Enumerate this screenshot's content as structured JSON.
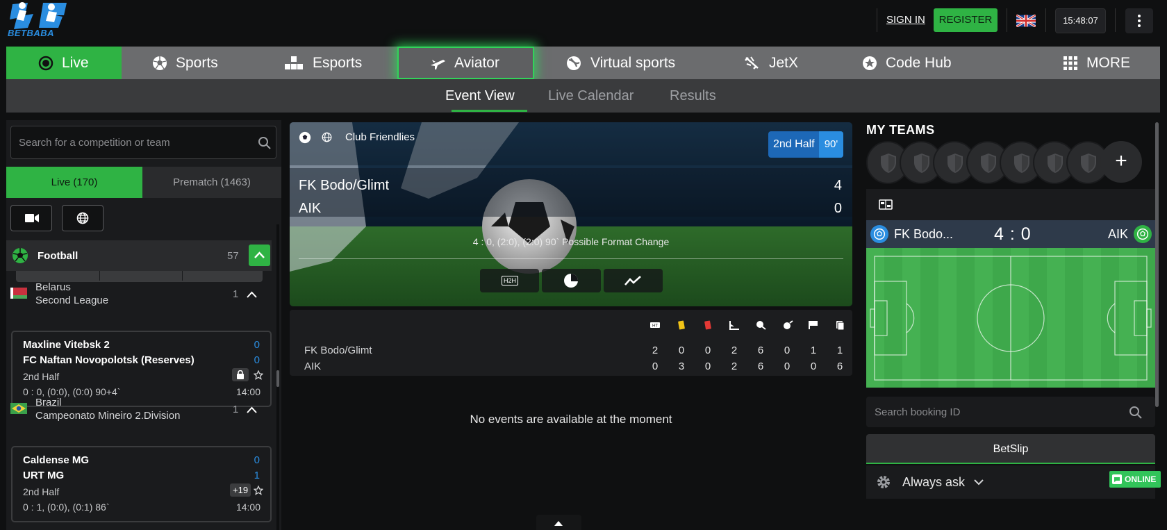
{
  "brand": {
    "logo_text": "BETBABA"
  },
  "header": {
    "signin": "SIGN IN",
    "register": "REGISTER",
    "clock": "15:48:07"
  },
  "nav": [
    {
      "label": "Live"
    },
    {
      "label": "Sports"
    },
    {
      "label": "Esports"
    },
    {
      "label": "Aviator"
    },
    {
      "label": "Virtual sports"
    },
    {
      "label": "JetX"
    },
    {
      "label": "Code Hub"
    },
    {
      "label": "MORE"
    }
  ],
  "subnav": {
    "event_view": "Event View",
    "live_calendar": "Live Calendar",
    "results": "Results"
  },
  "sidebar": {
    "search_placeholder": "Search for a competition or team",
    "tab_live": "Live (170)",
    "tab_prematch": "Prematch (1463)",
    "sport": {
      "label": "Football",
      "count": "57"
    },
    "leagues": [
      {
        "country": "Belarus",
        "name": "Second League",
        "count": "1",
        "match": {
          "home": "Maxline Vitebsk 2",
          "away": "FC Naftan Novopolotsk (Reserves)",
          "home_score": "0",
          "away_score": "0",
          "period": "2nd Half",
          "score_line": "0 : 0, (0:0), (0:0) 90+4`",
          "time": "14:00",
          "badge": ""
        }
      },
      {
        "country": "Brazil",
        "name": "Campeonato Mineiro 2.Division",
        "count": "1",
        "match": {
          "home": "Caldense MG",
          "away": "URT MG",
          "home_score": "0",
          "away_score": "1",
          "period": "2nd Half",
          "score_line": "0 : 1, (0:0), (0:1) 86`",
          "time": "14:00",
          "badge": "+19"
        }
      }
    ]
  },
  "event": {
    "competition": "Club Friendlies",
    "period": "2nd Half",
    "minute": "90'",
    "home": "FK Bodo/Glimt",
    "away": "AIK",
    "home_score": "4",
    "away_score": "0",
    "info": "4 : 0, (2:0), (2:0) 90` Possible Format Change",
    "h2h_label": "H2H"
  },
  "stats": {
    "home": {
      "name": "FK Bodo/Glimt",
      "values": [
        "2",
        "0",
        "0",
        "2",
        "6",
        "0",
        "1",
        "1"
      ]
    },
    "away": {
      "name": "AIK",
      "values": [
        "0",
        "3",
        "0",
        "2",
        "6",
        "0",
        "0",
        "6"
      ]
    }
  },
  "empty_message": "No events are available at the moment",
  "right": {
    "my_teams": "MY TEAMS",
    "plus": "+",
    "match_home": "FK Bodo...",
    "match_score": "4 : 0",
    "match_away": "AIK",
    "booking_placeholder": "Search booking ID",
    "betslip": "BetSlip",
    "always_ask": "Always ask",
    "online": "ONLINE"
  },
  "colors": {
    "accent": "#2fb344",
    "blue": "#2a8de0",
    "nav_bg": "#6b6c6e"
  }
}
